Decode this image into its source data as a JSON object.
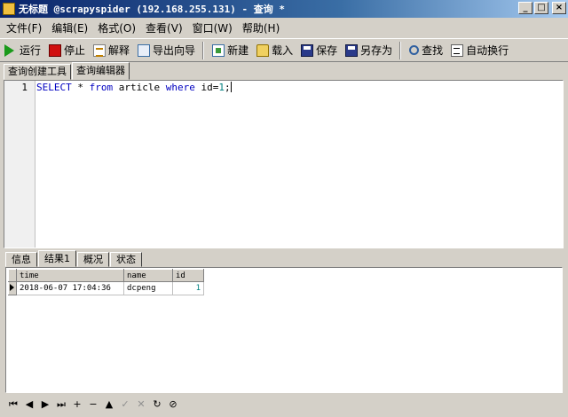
{
  "window": {
    "title": "无标题 @scrapyspider (192.168.255.131) - 查询 *"
  },
  "window_controls": {
    "minimize": "_",
    "maximize": "□",
    "close": "×"
  },
  "menu": [
    "文件(F)",
    "编辑(E)",
    "格式(O)",
    "查看(V)",
    "窗口(W)",
    "帮助(H)"
  ],
  "toolbar": {
    "run": "运行",
    "stop": "停止",
    "explain": "解释",
    "export": "导出向导",
    "new": "新建",
    "load": "载入",
    "save": "保存",
    "saveas": "另存为",
    "find": "查找",
    "wrap": "自动换行"
  },
  "top_tabs": [
    "查询创建工具",
    "查询编辑器"
  ],
  "editor": {
    "line_number": "1",
    "sql": {
      "kw1": "SELECT",
      "t1": " * ",
      "kw2": "from",
      "t2": " article ",
      "kw3": "where",
      "t3": " id=",
      "num": "1",
      "t4": ";"
    }
  },
  "result_tabs": [
    "信息",
    "结果1",
    "概况",
    "状态"
  ],
  "grid": {
    "columns": [
      "time",
      "name",
      "id"
    ],
    "rows": [
      {
        "time": "2018-06-07 17:04:36",
        "name": "dcpeng",
        "id": "1"
      }
    ]
  },
  "navigator": [
    "⏮",
    "◀",
    "▶",
    "⏭",
    "+",
    "−",
    "▲",
    "✓",
    "✕",
    "↻",
    "⊘"
  ]
}
